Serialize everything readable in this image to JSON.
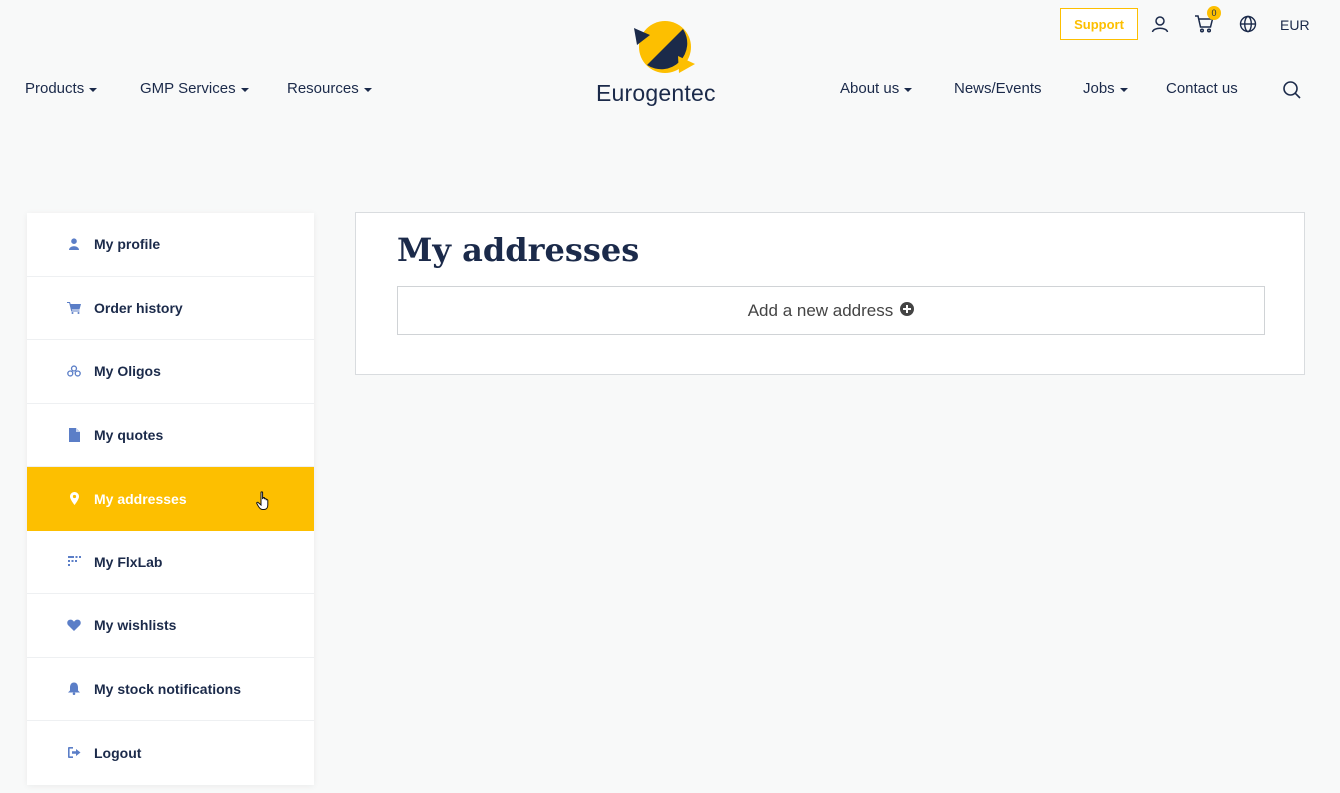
{
  "utility": {
    "support_label": "Support",
    "cart_count": "0",
    "currency": "EUR"
  },
  "brand": {
    "name": "Eurogentec",
    "colors": {
      "navy": "#1b2a4a",
      "yellow": "#fdbf00"
    }
  },
  "nav": {
    "left": [
      {
        "label": "Products",
        "has_dropdown": true
      },
      {
        "label": "GMP Services",
        "has_dropdown": true
      },
      {
        "label": "Resources",
        "has_dropdown": true
      }
    ],
    "right": [
      {
        "label": "About us",
        "has_dropdown": true
      },
      {
        "label": "News/Events",
        "has_dropdown": false
      },
      {
        "label": "Jobs",
        "has_dropdown": true
      },
      {
        "label": "Contact us",
        "has_dropdown": false
      }
    ]
  },
  "sidebar": {
    "items": [
      {
        "label": "My profile",
        "icon": "user-icon"
      },
      {
        "label": "Order history",
        "icon": "cart-icon"
      },
      {
        "label": "My Oligos",
        "icon": "oligos-icon"
      },
      {
        "label": "My quotes",
        "icon": "document-icon"
      },
      {
        "label": "My addresses",
        "icon": "map-pin-icon",
        "active": true
      },
      {
        "label": "My FlxLab",
        "icon": "flxlab-icon"
      },
      {
        "label": "My wishlists",
        "icon": "heart-icon"
      },
      {
        "label": "My stock notifications",
        "icon": "bell-icon"
      },
      {
        "label": "Logout",
        "icon": "logout-icon"
      }
    ]
  },
  "main": {
    "title": "My addresses",
    "add_address_label": "Add a new address"
  }
}
